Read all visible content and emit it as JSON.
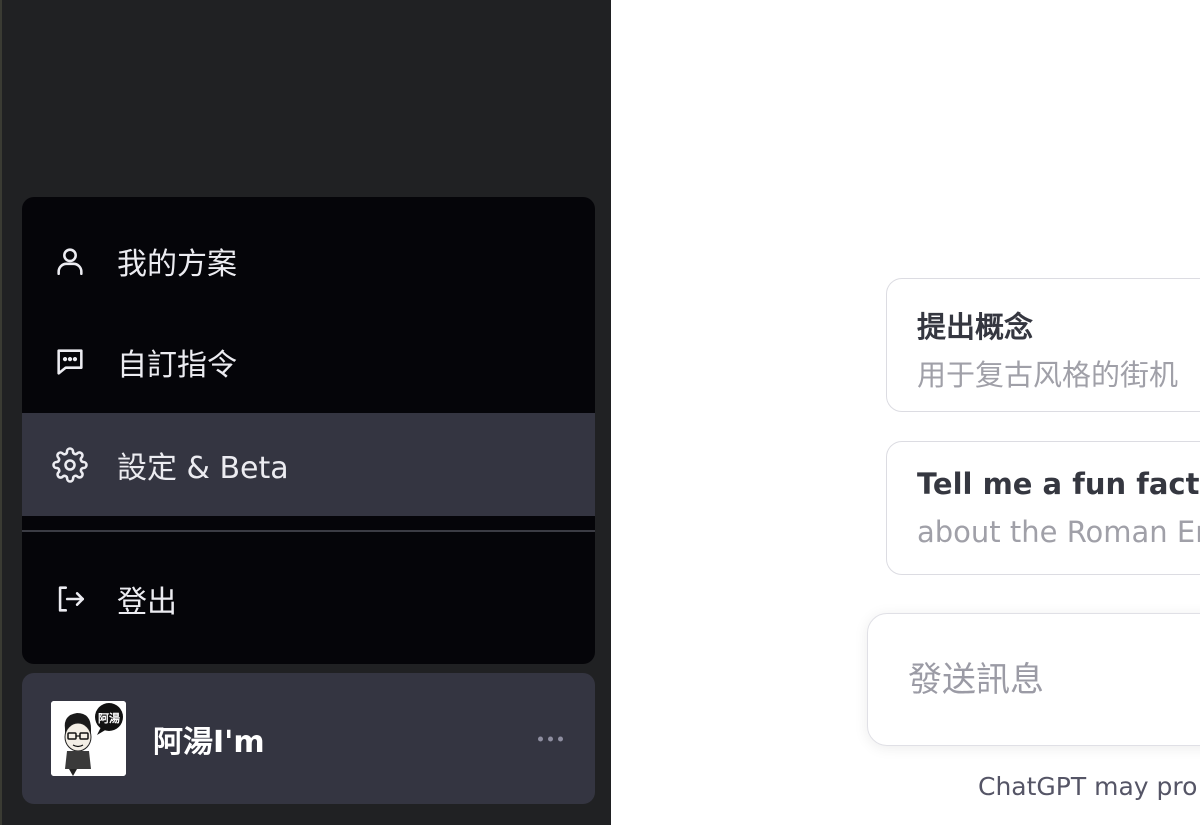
{
  "menu": {
    "items": [
      {
        "label": "我的方案",
        "icon": "user-icon"
      },
      {
        "label": "自訂指令",
        "icon": "chat-bubble-icon"
      },
      {
        "label": "設定 & Beta",
        "icon": "gear-icon"
      },
      {
        "label": "登出",
        "icon": "logout-icon"
      }
    ]
  },
  "user": {
    "name": "阿湯I'm",
    "avatar_badge": "阿湯",
    "more_icon": "more-horizontal-icon"
  },
  "suggestions": [
    {
      "title": "提出概念",
      "subtitle": "用于复古风格的街机"
    },
    {
      "title": "Tell me a fun fact",
      "subtitle": "about the Roman Em"
    }
  ],
  "composer": {
    "placeholder": "發送訊息"
  },
  "disclaimer": "ChatGPT may pro",
  "colors": {
    "sidebar_bg": "#202123",
    "menu_bg": "#050509",
    "menu_active_bg": "#343541",
    "text_light": "#ececf1"
  }
}
